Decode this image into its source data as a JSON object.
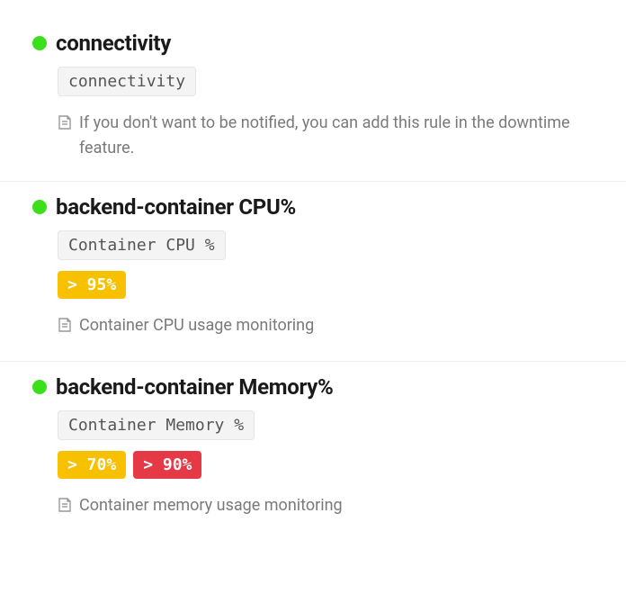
{
  "monitors": [
    {
      "title": "connectivity",
      "metric_label": "connectivity",
      "thresholds": [],
      "description": "If you don't want to be notified, you can add this rule in the downtime feature."
    },
    {
      "title": "backend-container CPU%",
      "metric_label": "Container CPU %",
      "thresholds": [
        {
          "label": "> 95%",
          "level": "warning"
        }
      ],
      "description": "Container CPU usage monitoring"
    },
    {
      "title": "backend-container Memory%",
      "metric_label": "Container Memory %",
      "thresholds": [
        {
          "label": "> 70%",
          "level": "warning"
        },
        {
          "label": "> 90%",
          "level": "critical"
        }
      ],
      "description": "Container memory usage monitoring"
    }
  ],
  "colors": {
    "status_ok": "#3bdf1a",
    "warning": "#f7c000",
    "critical": "#e63946"
  }
}
